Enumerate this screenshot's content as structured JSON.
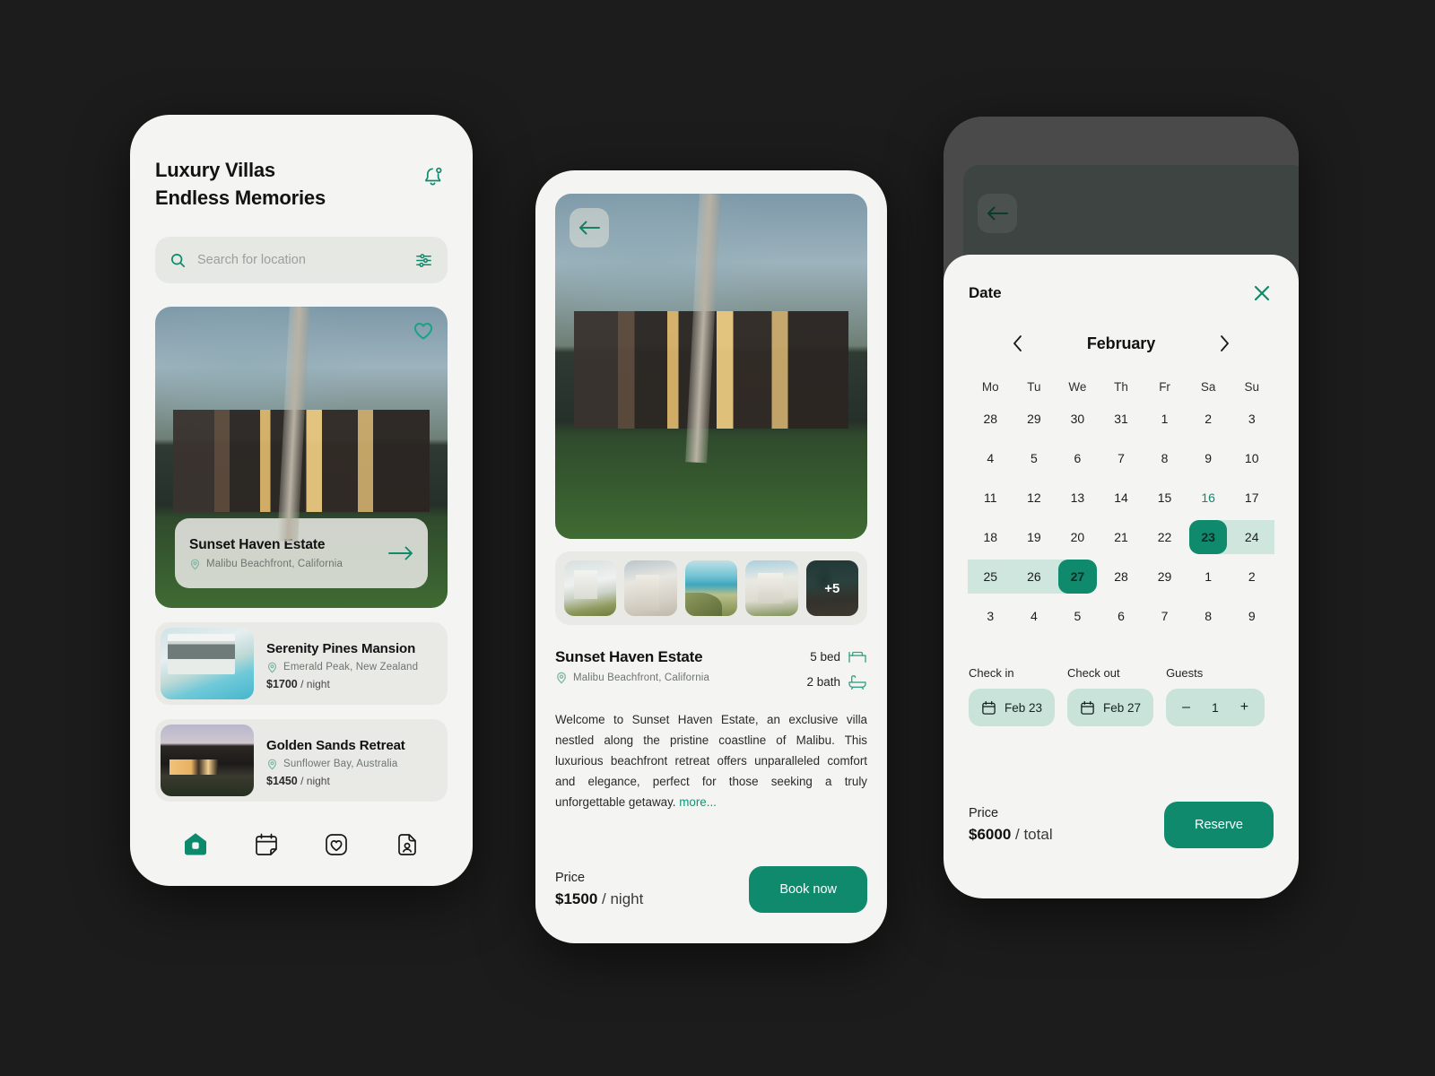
{
  "accent": "#0f8a6d",
  "home": {
    "title_line1": "Luxury Villas",
    "title_line2": "Endless Memories",
    "bell_icon": "notification-bell-icon",
    "search": {
      "placeholder": "Search for location",
      "value": "",
      "filter_icon": "filter-sliders-icon"
    },
    "hero": {
      "name": "Sunset Haven Estate",
      "location": "Malibu Beachfront, California",
      "favorite_icon": "heart-icon",
      "arrow_icon": "arrow-right-icon",
      "pin_icon": "location-pin-icon"
    },
    "listings": [
      {
        "name": "Serenity Pines Mansion",
        "location": "Emerald Peak, New Zealand",
        "price": "$1700",
        "per": "/ night"
      },
      {
        "name": "Golden Sands Retreat",
        "location": "Sunflower Bay, Australia",
        "price": "$1450",
        "per": "/ night"
      }
    ],
    "tabs": [
      {
        "name": "home",
        "icon": "home-icon",
        "active": true
      },
      {
        "name": "bookings",
        "icon": "calendar-icon",
        "active": false
      },
      {
        "name": "favorites",
        "icon": "heart-square-icon",
        "active": false
      },
      {
        "name": "profile",
        "icon": "profile-document-icon",
        "active": false
      }
    ]
  },
  "detail": {
    "back_icon": "arrow-left-icon",
    "gallery_more": "+5",
    "name": "Sunset Haven Estate",
    "location": "Malibu Beachfront, California",
    "beds": "5 bed",
    "baths": "2 bath",
    "bed_icon": "bed-icon",
    "bath_icon": "bath-icon",
    "description": "Welcome to Sunset Haven Estate, an exclusive villa nestled along the pristine coastline of Malibu. This luxurious beachfront retreat offers unparalleled comfort and elegance, perfect for those seeking a truly unforgettable getaway.",
    "more_label": "more...",
    "price_label": "Price",
    "price_value": "$1500",
    "price_unit": "/ night",
    "book_label": "Book now"
  },
  "booking": {
    "back_icon": "arrow-left-icon",
    "sheet_title": "Date",
    "close_icon": "close-x-icon",
    "prev_icon": "chevron-left-icon",
    "next_icon": "chevron-right-icon",
    "month": "February",
    "weekdays": [
      "Mo",
      "Tu",
      "We",
      "Th",
      "Fr",
      "Sa",
      "Su"
    ],
    "weeks": [
      [
        {
          "d": "28"
        },
        {
          "d": "29"
        },
        {
          "d": "30"
        },
        {
          "d": "31"
        },
        {
          "d": "1"
        },
        {
          "d": "2"
        },
        {
          "d": "3"
        }
      ],
      [
        {
          "d": "4"
        },
        {
          "d": "5"
        },
        {
          "d": "6"
        },
        {
          "d": "7"
        },
        {
          "d": "8"
        },
        {
          "d": "9"
        },
        {
          "d": "10"
        }
      ],
      [
        {
          "d": "11"
        },
        {
          "d": "12"
        },
        {
          "d": "13"
        },
        {
          "d": "14"
        },
        {
          "d": "15"
        },
        {
          "d": "16",
          "today": true
        },
        {
          "d": "17"
        }
      ],
      [
        {
          "d": "18"
        },
        {
          "d": "19"
        },
        {
          "d": "20"
        },
        {
          "d": "21"
        },
        {
          "d": "22"
        },
        {
          "d": "23",
          "sel": true,
          "range": "start"
        },
        {
          "d": "24",
          "range": "mid"
        }
      ],
      [
        {
          "d": "25",
          "range": "mid"
        },
        {
          "d": "26",
          "range": "mid"
        },
        {
          "d": "27",
          "sel": true,
          "range": "end"
        },
        {
          "d": "28"
        },
        {
          "d": "29"
        },
        {
          "d": "1"
        },
        {
          "d": "2"
        }
      ],
      [
        {
          "d": "3"
        },
        {
          "d": "4"
        },
        {
          "d": "5"
        },
        {
          "d": "6"
        },
        {
          "d": "7"
        },
        {
          "d": "8"
        },
        {
          "d": "9"
        }
      ]
    ],
    "checkin_label": "Check in",
    "checkin_value": "Feb 23",
    "checkout_label": "Check out",
    "checkout_value": "Feb 27",
    "guests_label": "Guests",
    "guests_value": "1",
    "guests_minus": "–",
    "guests_plus": "+",
    "calendar_icon": "calendar-small-icon",
    "price_label": "Price",
    "price_value": "$6000",
    "price_unit": "/ total",
    "reserve_label": "Reserve"
  }
}
